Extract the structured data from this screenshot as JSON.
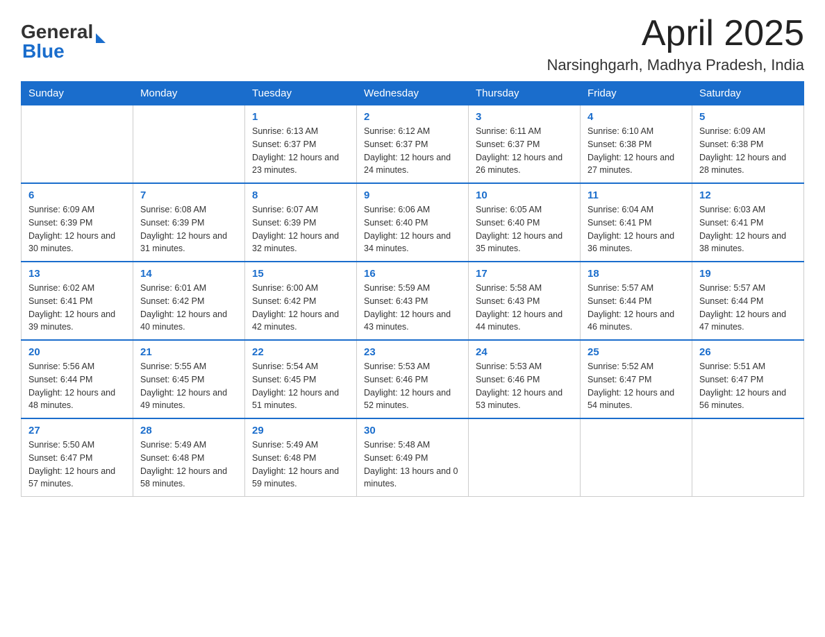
{
  "header": {
    "logo_general": "General",
    "logo_blue": "Blue",
    "month_title": "April 2025",
    "location": "Narsinghgarh, Madhya Pradesh, India"
  },
  "weekdays": [
    "Sunday",
    "Monday",
    "Tuesday",
    "Wednesday",
    "Thursday",
    "Friday",
    "Saturday"
  ],
  "weeks": [
    [
      {
        "day": "",
        "sunrise": "",
        "sunset": "",
        "daylight": ""
      },
      {
        "day": "",
        "sunrise": "",
        "sunset": "",
        "daylight": ""
      },
      {
        "day": "1",
        "sunrise": "Sunrise: 6:13 AM",
        "sunset": "Sunset: 6:37 PM",
        "daylight": "Daylight: 12 hours and 23 minutes."
      },
      {
        "day": "2",
        "sunrise": "Sunrise: 6:12 AM",
        "sunset": "Sunset: 6:37 PM",
        "daylight": "Daylight: 12 hours and 24 minutes."
      },
      {
        "day": "3",
        "sunrise": "Sunrise: 6:11 AM",
        "sunset": "Sunset: 6:37 PM",
        "daylight": "Daylight: 12 hours and 26 minutes."
      },
      {
        "day": "4",
        "sunrise": "Sunrise: 6:10 AM",
        "sunset": "Sunset: 6:38 PM",
        "daylight": "Daylight: 12 hours and 27 minutes."
      },
      {
        "day": "5",
        "sunrise": "Sunrise: 6:09 AM",
        "sunset": "Sunset: 6:38 PM",
        "daylight": "Daylight: 12 hours and 28 minutes."
      }
    ],
    [
      {
        "day": "6",
        "sunrise": "Sunrise: 6:09 AM",
        "sunset": "Sunset: 6:39 PM",
        "daylight": "Daylight: 12 hours and 30 minutes."
      },
      {
        "day": "7",
        "sunrise": "Sunrise: 6:08 AM",
        "sunset": "Sunset: 6:39 PM",
        "daylight": "Daylight: 12 hours and 31 minutes."
      },
      {
        "day": "8",
        "sunrise": "Sunrise: 6:07 AM",
        "sunset": "Sunset: 6:39 PM",
        "daylight": "Daylight: 12 hours and 32 minutes."
      },
      {
        "day": "9",
        "sunrise": "Sunrise: 6:06 AM",
        "sunset": "Sunset: 6:40 PM",
        "daylight": "Daylight: 12 hours and 34 minutes."
      },
      {
        "day": "10",
        "sunrise": "Sunrise: 6:05 AM",
        "sunset": "Sunset: 6:40 PM",
        "daylight": "Daylight: 12 hours and 35 minutes."
      },
      {
        "day": "11",
        "sunrise": "Sunrise: 6:04 AM",
        "sunset": "Sunset: 6:41 PM",
        "daylight": "Daylight: 12 hours and 36 minutes."
      },
      {
        "day": "12",
        "sunrise": "Sunrise: 6:03 AM",
        "sunset": "Sunset: 6:41 PM",
        "daylight": "Daylight: 12 hours and 38 minutes."
      }
    ],
    [
      {
        "day": "13",
        "sunrise": "Sunrise: 6:02 AM",
        "sunset": "Sunset: 6:41 PM",
        "daylight": "Daylight: 12 hours and 39 minutes."
      },
      {
        "day": "14",
        "sunrise": "Sunrise: 6:01 AM",
        "sunset": "Sunset: 6:42 PM",
        "daylight": "Daylight: 12 hours and 40 minutes."
      },
      {
        "day": "15",
        "sunrise": "Sunrise: 6:00 AM",
        "sunset": "Sunset: 6:42 PM",
        "daylight": "Daylight: 12 hours and 42 minutes."
      },
      {
        "day": "16",
        "sunrise": "Sunrise: 5:59 AM",
        "sunset": "Sunset: 6:43 PM",
        "daylight": "Daylight: 12 hours and 43 minutes."
      },
      {
        "day": "17",
        "sunrise": "Sunrise: 5:58 AM",
        "sunset": "Sunset: 6:43 PM",
        "daylight": "Daylight: 12 hours and 44 minutes."
      },
      {
        "day": "18",
        "sunrise": "Sunrise: 5:57 AM",
        "sunset": "Sunset: 6:44 PM",
        "daylight": "Daylight: 12 hours and 46 minutes."
      },
      {
        "day": "19",
        "sunrise": "Sunrise: 5:57 AM",
        "sunset": "Sunset: 6:44 PM",
        "daylight": "Daylight: 12 hours and 47 minutes."
      }
    ],
    [
      {
        "day": "20",
        "sunrise": "Sunrise: 5:56 AM",
        "sunset": "Sunset: 6:44 PM",
        "daylight": "Daylight: 12 hours and 48 minutes."
      },
      {
        "day": "21",
        "sunrise": "Sunrise: 5:55 AM",
        "sunset": "Sunset: 6:45 PM",
        "daylight": "Daylight: 12 hours and 49 minutes."
      },
      {
        "day": "22",
        "sunrise": "Sunrise: 5:54 AM",
        "sunset": "Sunset: 6:45 PM",
        "daylight": "Daylight: 12 hours and 51 minutes."
      },
      {
        "day": "23",
        "sunrise": "Sunrise: 5:53 AM",
        "sunset": "Sunset: 6:46 PM",
        "daylight": "Daylight: 12 hours and 52 minutes."
      },
      {
        "day": "24",
        "sunrise": "Sunrise: 5:53 AM",
        "sunset": "Sunset: 6:46 PM",
        "daylight": "Daylight: 12 hours and 53 minutes."
      },
      {
        "day": "25",
        "sunrise": "Sunrise: 5:52 AM",
        "sunset": "Sunset: 6:47 PM",
        "daylight": "Daylight: 12 hours and 54 minutes."
      },
      {
        "day": "26",
        "sunrise": "Sunrise: 5:51 AM",
        "sunset": "Sunset: 6:47 PM",
        "daylight": "Daylight: 12 hours and 56 minutes."
      }
    ],
    [
      {
        "day": "27",
        "sunrise": "Sunrise: 5:50 AM",
        "sunset": "Sunset: 6:47 PM",
        "daylight": "Daylight: 12 hours and 57 minutes."
      },
      {
        "day": "28",
        "sunrise": "Sunrise: 5:49 AM",
        "sunset": "Sunset: 6:48 PM",
        "daylight": "Daylight: 12 hours and 58 minutes."
      },
      {
        "day": "29",
        "sunrise": "Sunrise: 5:49 AM",
        "sunset": "Sunset: 6:48 PM",
        "daylight": "Daylight: 12 hours and 59 minutes."
      },
      {
        "day": "30",
        "sunrise": "Sunrise: 5:48 AM",
        "sunset": "Sunset: 6:49 PM",
        "daylight": "Daylight: 13 hours and 0 minutes."
      },
      {
        "day": "",
        "sunrise": "",
        "sunset": "",
        "daylight": ""
      },
      {
        "day": "",
        "sunrise": "",
        "sunset": "",
        "daylight": ""
      },
      {
        "day": "",
        "sunrise": "",
        "sunset": "",
        "daylight": ""
      }
    ]
  ]
}
